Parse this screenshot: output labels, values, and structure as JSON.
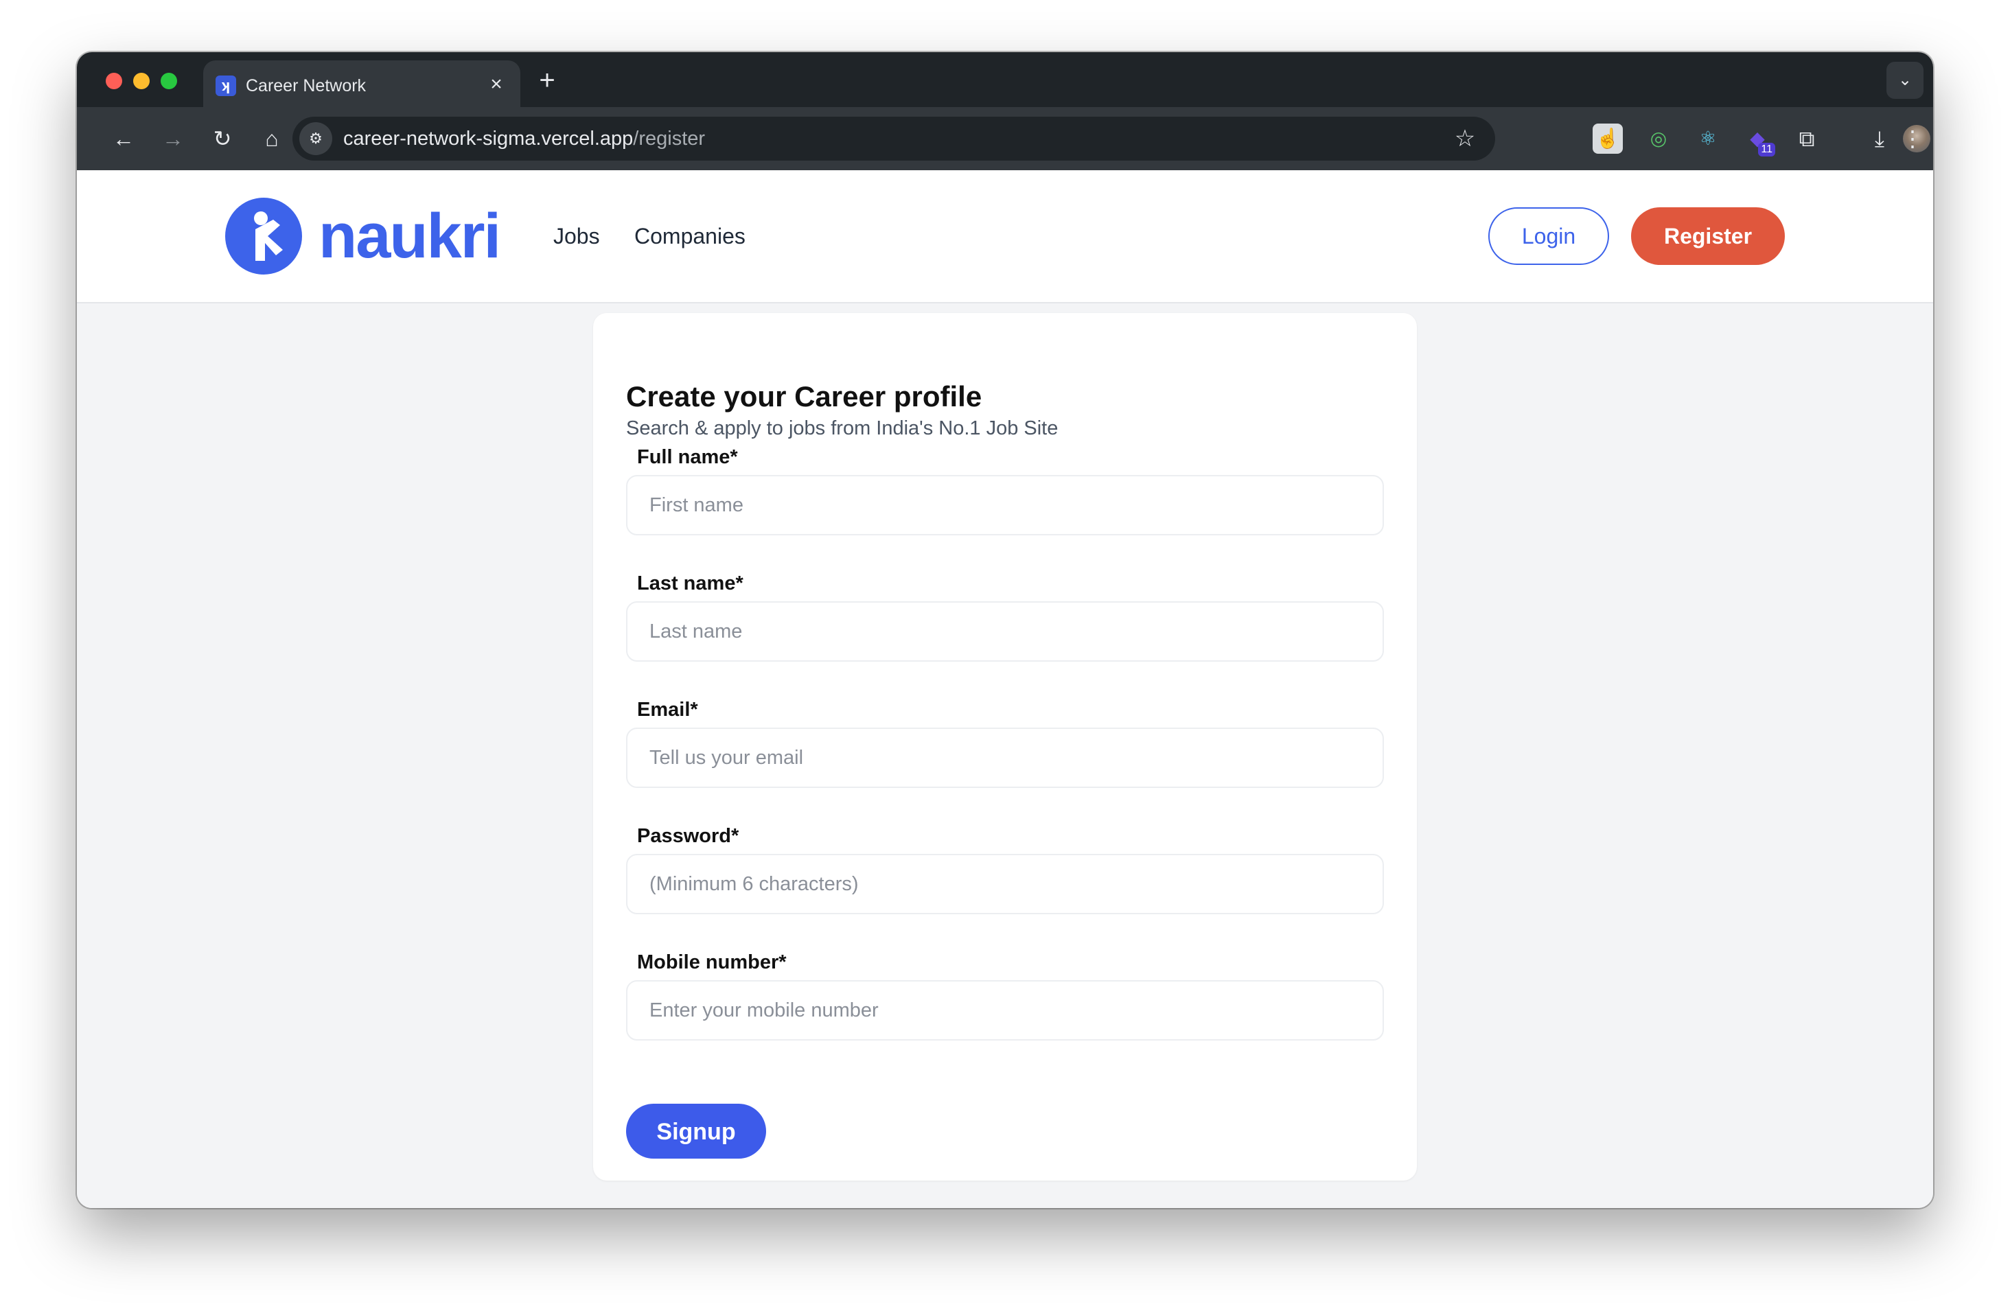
{
  "browser": {
    "tab_title": "Career Network",
    "tab_favicon": "naukri-favicon-icon",
    "url_host": "career-network-sigma.vercel.app",
    "url_path": "/register",
    "extension_badge": "11"
  },
  "site": {
    "brand": "naukri",
    "nav": {
      "jobs": "Jobs",
      "companies": "Companies"
    },
    "login_label": "Login",
    "register_label": "Register"
  },
  "form": {
    "title": "Create your Career profile",
    "subtitle": "Search & apply to jobs from India's No.1 Job Site",
    "fields": [
      {
        "label": "Full name*",
        "placeholder": "First name"
      },
      {
        "label": "Last name*",
        "placeholder": "Last name"
      },
      {
        "label": "Email*",
        "placeholder": "Tell us your email"
      },
      {
        "label": "Password*",
        "placeholder": "(Minimum 6 characters)"
      },
      {
        "label": "Mobile number*",
        "placeholder": "Enter your mobile number"
      }
    ],
    "submit_label": "Signup"
  },
  "colors": {
    "brand_blue": "#3d63ea",
    "register_orange": "#e0573d",
    "signup_blue": "#3d5bea"
  }
}
